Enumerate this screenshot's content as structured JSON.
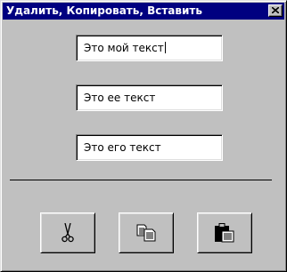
{
  "window": {
    "title": "Удалить, Копировать, Вставить",
    "close_icon": "close-icon"
  },
  "fields": [
    {
      "value": "Это мой текст"
    },
    {
      "value": "Это ее текст"
    },
    {
      "value": "Это его текст"
    }
  ],
  "toolbar": {
    "buttons": [
      {
        "icon": "scissors-icon",
        "action": "cut"
      },
      {
        "icon": "copy-icon",
        "action": "copy"
      },
      {
        "icon": "clipboard-paste-icon",
        "action": "paste"
      }
    ]
  },
  "colors": {
    "face": "#c0c0c0",
    "titlebar": "#000080",
    "title_text": "#ffffff"
  }
}
